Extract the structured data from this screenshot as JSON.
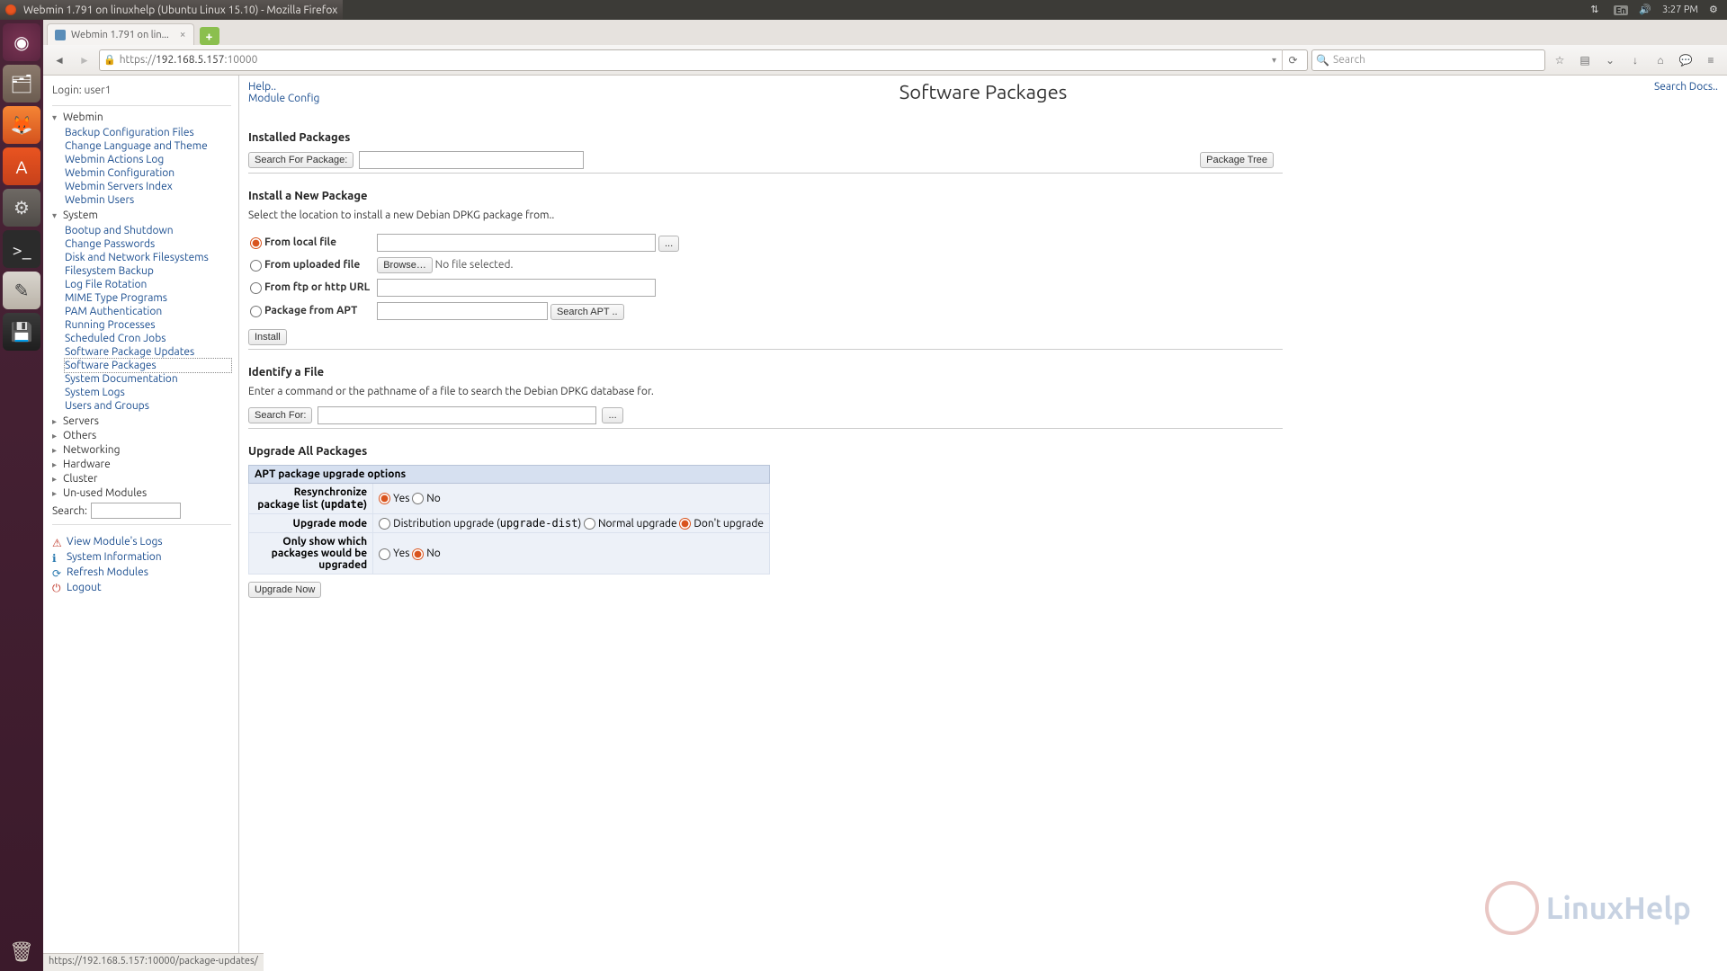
{
  "titlebar": "Webmin 1.791 on linuxhelp (Ubuntu Linux 15.10) - Mozilla Firefox",
  "menubar": {
    "lang": "En",
    "time": "3:27 PM"
  },
  "tab": {
    "title": "Webmin 1.791 on lin..."
  },
  "url": {
    "scheme": "https://",
    "host": "192.168.5.157",
    "port": ":10000"
  },
  "search_placeholder": "Search",
  "sidebar": {
    "login": "Login: user1",
    "cats": {
      "webmin": {
        "label": "Webmin",
        "items": [
          "Backup Configuration Files",
          "Change Language and Theme",
          "Webmin Actions Log",
          "Webmin Configuration",
          "Webmin Servers Index",
          "Webmin Users"
        ]
      },
      "system": {
        "label": "System",
        "items": [
          "Bootup and Shutdown",
          "Change Passwords",
          "Disk and Network Filesystems",
          "Filesystem Backup",
          "Log File Rotation",
          "MIME Type Programs",
          "PAM Authentication",
          "Running Processes",
          "Scheduled Cron Jobs",
          "Software Package Updates",
          "Software Packages",
          "System Documentation",
          "System Logs",
          "Users and Groups"
        ]
      },
      "servers": "Servers",
      "others": "Others",
      "networking": "Networking",
      "hardware": "Hardware",
      "cluster": "Cluster",
      "unused": "Un-used Modules"
    },
    "search_label": "Search:",
    "footer": {
      "viewlogs": "View Module's Logs",
      "sysinfo": "System Information",
      "refresh": "Refresh Modules",
      "logout": "Logout"
    }
  },
  "main": {
    "help": "Help..",
    "module_config": "Module Config",
    "title": "Software Packages",
    "search_docs": "Search Docs..",
    "installed": {
      "heading": "Installed Packages",
      "search_btn": "Search For Package:",
      "tree_btn": "Package Tree"
    },
    "install": {
      "heading": "Install a New Package",
      "intro": "Select the location to install a new Debian DPKG package from..",
      "local": "From local file",
      "uploaded": "From uploaded file",
      "browse": "Browse…",
      "nofile": "No file selected.",
      "url": "From ftp or http URL",
      "apt": "Package from APT",
      "searchapt": "Search APT ..",
      "install_btn": "Install",
      "dots": "..."
    },
    "identify": {
      "heading": "Identify a File",
      "intro": "Enter a command or the pathname of a file to search the Debian DPKG database for.",
      "search_btn": "Search For:",
      "dots": "..."
    },
    "upgrade": {
      "heading": "Upgrade All Packages",
      "boxtitle": "APT package upgrade options",
      "resync_pre": "Resynchronize package list (",
      "resync_mono": "update",
      "resync_post": ")",
      "yes": "Yes",
      "no": "No",
      "mode_label": "Upgrade mode",
      "mode1_pre": "Distribution upgrade (",
      "mode1_mono": "upgrade-dist",
      "mode1_post": ")",
      "mode2": "Normal upgrade",
      "mode3": "Don't upgrade",
      "onlyshow": "Only show which packages would be upgraded",
      "now_btn": "Upgrade Now"
    }
  },
  "statusbar": "https://192.168.5.157:10000/package-updates/",
  "watermark": "LinuxHelp"
}
